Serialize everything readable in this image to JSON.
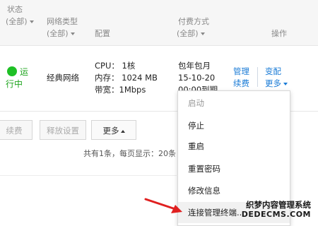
{
  "table": {
    "headers": {
      "status": "状态",
      "status_filter": "(全部)",
      "network_type": "网络类型",
      "network_filter": "(全部)",
      "config": "配置",
      "billing": "付费方式",
      "billing_filter": "(全部)",
      "actions": "操作"
    },
    "row": {
      "status_line1": "运",
      "status_line2": "行中",
      "network": "经典网络",
      "cpu": "CPU： 1核",
      "memory": "内存： 1024 MB",
      "bandwidth": "带宽：1Mbps",
      "billing_line1": "包年包月",
      "billing_line2": "15-10-20",
      "billing_line3": "00:00到期",
      "action_manage": "管理",
      "action_renew": "续费",
      "action_change": "变配",
      "action_more": "更多"
    }
  },
  "toolbar": {
    "renew_button": "续费",
    "release_button": "释放设置",
    "more_button": "更多"
  },
  "pager": {
    "summary": "共有1条，每页显示：20条"
  },
  "dropdown": {
    "items": [
      {
        "label": "启动",
        "enabled": false
      },
      {
        "label": "停止",
        "enabled": true
      },
      {
        "label": "重启",
        "enabled": true
      },
      {
        "label": "重置密码",
        "enabled": true
      },
      {
        "label": "修改信息",
        "enabled": true
      },
      {
        "label": "连接管理终端...",
        "enabled": true
      }
    ]
  },
  "watermark": {
    "title": "织梦内容管理系统",
    "url": "DEDECMS.COM"
  },
  "colors": {
    "accent_link": "#1a7bd6",
    "status_running": "#1ec025",
    "arrow": "#e02020"
  }
}
